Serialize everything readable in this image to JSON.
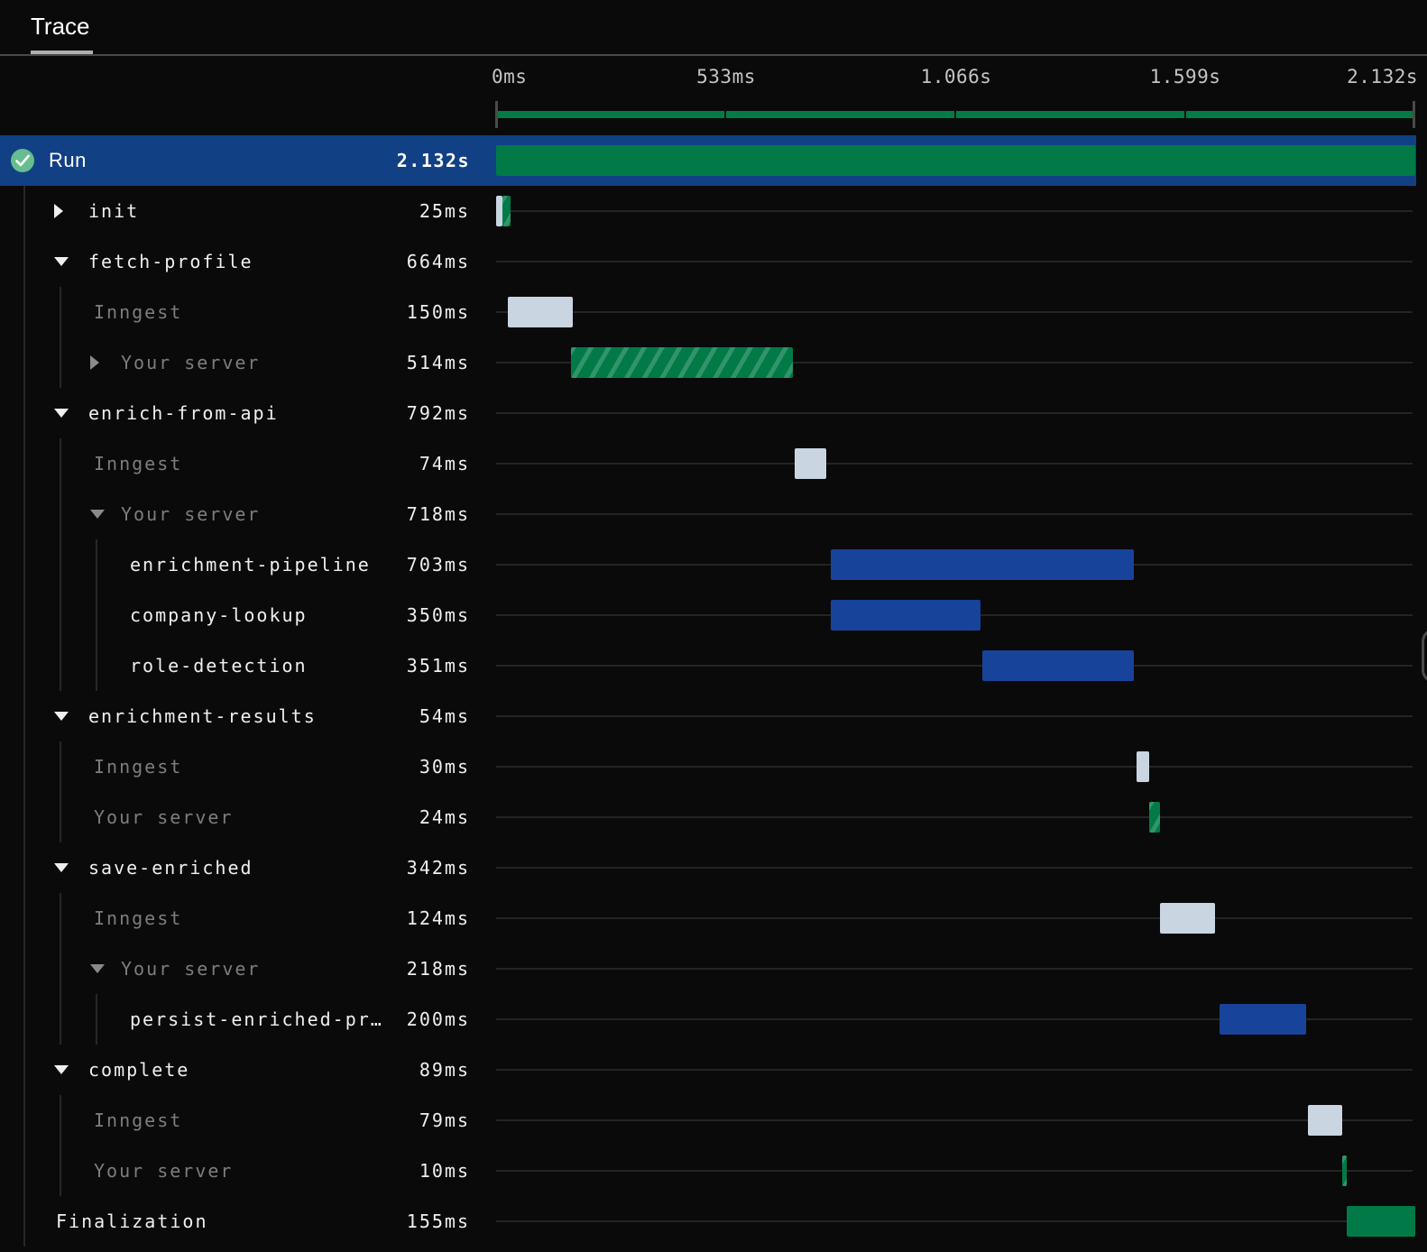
{
  "header": {
    "tab": "Trace"
  },
  "axis": {
    "labels": [
      "0ms",
      "533ms",
      "1.066s",
      "1.599s",
      "2.132s"
    ],
    "total_ms": 2132
  },
  "colors": {
    "background": "#0a0a0a",
    "selected_row": "#124085",
    "queued_bar": "#c9d5e1",
    "server_bar_green": "#027a48",
    "step_bar_blue": "#17439a",
    "hatch_stripe": "#31946a",
    "check_badge": "#67bd8f",
    "muted_text": "#7d7d7d",
    "text": "#efefef"
  },
  "rows": [
    {
      "name": "Run",
      "duration": "2.132s",
      "kind": "run",
      "icon": "check-circle",
      "selected": true,
      "bar": {
        "color": "green",
        "start": 0,
        "ms": 2132
      }
    },
    {
      "name": "init",
      "duration": "25ms",
      "level": 1,
      "caret": "right",
      "parts": [
        {
          "color": "light",
          "start": 0,
          "ms": 14
        },
        {
          "color": "hatch",
          "start": 14,
          "ms": 20
        }
      ]
    },
    {
      "name": "fetch-profile",
      "duration": "664ms",
      "level": 1,
      "caret": "down"
    },
    {
      "name": "Inngest",
      "duration": "150ms",
      "level": 2,
      "muted": true,
      "bar": {
        "color": "light",
        "start": 27,
        "ms": 150
      }
    },
    {
      "name": "Your server",
      "duration": "514ms",
      "level": 2,
      "muted": true,
      "caret": "right",
      "bar": {
        "color": "hatch",
        "start": 174,
        "ms": 514
      }
    },
    {
      "name": "enrich-from-api",
      "duration": "792ms",
      "level": 1,
      "caret": "down"
    },
    {
      "name": "Inngest",
      "duration": "74ms",
      "level": 2,
      "muted": true,
      "bar": {
        "color": "light",
        "start": 692,
        "ms": 74
      }
    },
    {
      "name": "Your server",
      "duration": "718ms",
      "level": 2,
      "muted": true,
      "caret": "down"
    },
    {
      "name": "enrichment-pipeline",
      "duration": "703ms",
      "level": 3,
      "bar": {
        "color": "blue",
        "start": 776,
        "ms": 703
      }
    },
    {
      "name": "company-lookup",
      "duration": "350ms",
      "level": 3,
      "bar": {
        "color": "blue",
        "start": 776,
        "ms": 347
      }
    },
    {
      "name": "role-detection",
      "duration": "351ms",
      "level": 3,
      "bar": {
        "color": "blue",
        "start": 1128,
        "ms": 351
      }
    },
    {
      "name": "enrichment-results",
      "duration": "54ms",
      "level": 1,
      "caret": "down"
    },
    {
      "name": "Inngest",
      "duration": "30ms",
      "level": 2,
      "muted": true,
      "bar": {
        "color": "light",
        "start": 1485,
        "ms": 30
      }
    },
    {
      "name": "Your server",
      "duration": "24ms",
      "level": 2,
      "muted": true,
      "bar": {
        "color": "hatch",
        "start": 1515,
        "ms": 25
      }
    },
    {
      "name": "save-enriched",
      "duration": "342ms",
      "level": 1,
      "caret": "down"
    },
    {
      "name": "Inngest",
      "duration": "124ms",
      "level": 2,
      "muted": true,
      "bar": {
        "color": "light",
        "start": 1540,
        "ms": 128
      }
    },
    {
      "name": "Your server",
      "duration": "218ms",
      "level": 2,
      "muted": true,
      "caret": "down"
    },
    {
      "name": "persist-enriched-pr…",
      "duration": "200ms",
      "level": 3,
      "bar": {
        "color": "blue",
        "start": 1678,
        "ms": 200
      }
    },
    {
      "name": "complete",
      "duration": "89ms",
      "level": 1,
      "caret": "down"
    },
    {
      "name": "Inngest",
      "duration": "79ms",
      "level": 2,
      "muted": true,
      "bar": {
        "color": "light",
        "start": 1883,
        "ms": 79
      }
    },
    {
      "name": "Your server",
      "duration": "10ms",
      "level": 2,
      "muted": true,
      "bar": {
        "color": "hatch",
        "start": 1962,
        "ms": 10
      }
    },
    {
      "name": "Finalization",
      "duration": "155ms",
      "level": 0,
      "bar": {
        "color": "green",
        "start": 1973,
        "ms": 159
      }
    }
  ],
  "scroll_indicator": true
}
